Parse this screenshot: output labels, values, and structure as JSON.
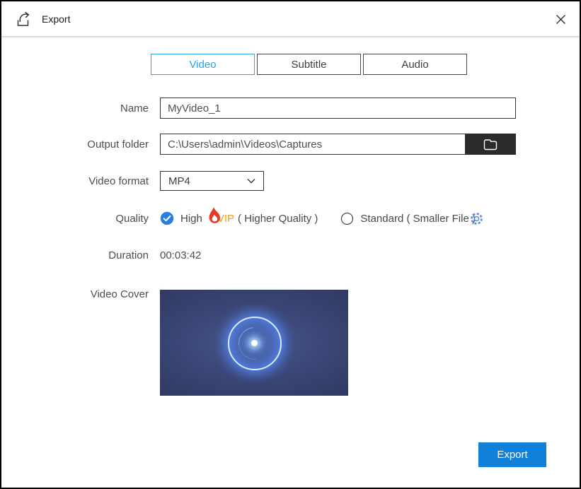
{
  "window": {
    "title": "Export"
  },
  "tabs": {
    "video": "Video",
    "subtitle": "Subtitle",
    "audio": "Audio"
  },
  "form": {
    "name": {
      "label": "Name",
      "value": "MyVideo_1"
    },
    "output_folder": {
      "label": "Output folder",
      "value": "C:\\Users\\admin\\Videos\\Captures"
    },
    "video_format": {
      "label": "Video format",
      "value": "MP4"
    },
    "quality": {
      "label": "Quality",
      "high_label": "High",
      "vip_label": "VIP",
      "high_suffix": "( Higher Quality )",
      "standard_label": "Standard ( Smaller File )",
      "selected": "High"
    },
    "duration": {
      "label": "Duration",
      "value": "00:03:42"
    },
    "video_cover": {
      "label": "Video Cover"
    }
  },
  "footer": {
    "export_label": "Export"
  },
  "icons": {
    "titlebar": "export-arrow-icon",
    "close": "close-icon",
    "folder_button": "folder-icon",
    "format_dropdown": "chevron-down-icon",
    "high_quality_badge": "flame-icon",
    "quality_settings": "gear-icon"
  },
  "colors": {
    "tab_active": "#29a3e8",
    "radio_selected": "#2a7de1",
    "gear_blue": "#5b8fd9",
    "vip_gold": "#f0a01c",
    "flame_red": "#e8392a",
    "export_button": "#1180d8",
    "folder_button_bg": "#2b2b2b"
  }
}
